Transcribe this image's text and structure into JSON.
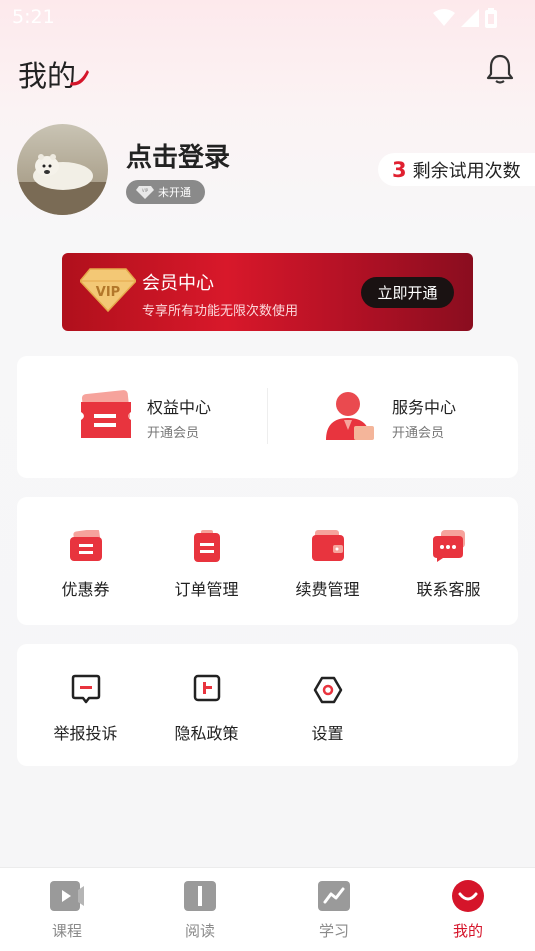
{
  "status": {
    "time": "5:21"
  },
  "header": {
    "title": "我的"
  },
  "profile": {
    "login_text": "点击登录",
    "member_status": "未开通",
    "trial_count": "3",
    "trial_label": "剩余试用次数"
  },
  "vip": {
    "title": "会员中心",
    "subtitle": "专享所有功能无限次数使用",
    "button": "立即开通",
    "badge_text": "VIP"
  },
  "rights": [
    {
      "title": "权益中心",
      "subtitle": "开通会员"
    },
    {
      "title": "服务中心",
      "subtitle": "开通会员"
    }
  ],
  "services": [
    {
      "label": "优惠券",
      "icon": "coupon-icon"
    },
    {
      "label": "订单管理",
      "icon": "order-icon"
    },
    {
      "label": "续费管理",
      "icon": "wallet-icon"
    },
    {
      "label": "联系客服",
      "icon": "chat-icon"
    }
  ],
  "others": [
    {
      "label": "举报投诉",
      "icon": "report-icon"
    },
    {
      "label": "隐私政策",
      "icon": "privacy-icon"
    },
    {
      "label": "设置",
      "icon": "settings-icon"
    }
  ],
  "tabs": [
    {
      "label": "课程",
      "icon": "video-icon",
      "active": false
    },
    {
      "label": "阅读",
      "icon": "book-icon",
      "active": false
    },
    {
      "label": "学习",
      "icon": "chart-icon",
      "active": false
    },
    {
      "label": "我的",
      "icon": "smile-icon",
      "active": true
    }
  ],
  "colors": {
    "accent": "#d5152a",
    "card": "#ffffff",
    "background": "#f6f6f7"
  }
}
